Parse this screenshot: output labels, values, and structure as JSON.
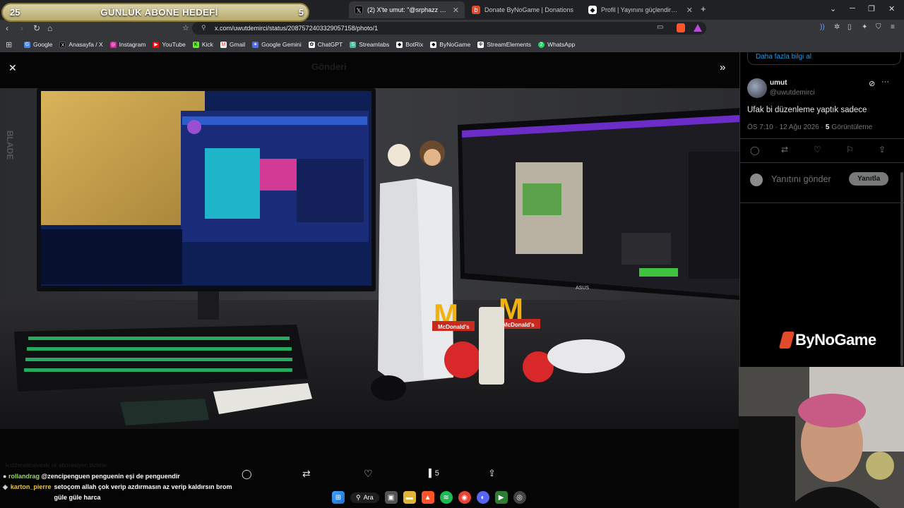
{
  "overlay": {
    "goal_left": "25",
    "goal_title": "GÜNLÜK ABONE HEDEFİ",
    "goal_right": "5"
  },
  "tabs": [
    {
      "label": "(2) X'te umut: \"@srphazz @setoi",
      "active": true
    },
    {
      "label": "Donate ByNoGame | Donations",
      "active": false
    },
    {
      "label": "Profil | Yayınını güçlendirmek için en",
      "active": false
    }
  ],
  "address": {
    "url": "x.com/uwutdemirci/status/2087572403329057158/photo/1"
  },
  "bookmarks": [
    "Google",
    "Anasayfa / X",
    "Instagram",
    "YouTube",
    "Kick",
    "Gmail",
    "Google Gemini",
    "ChatGPT",
    "Streamlabs",
    "BotRix",
    "ByNoGame",
    "StreamElements",
    "WhatsApp"
  ],
  "viewer": {
    "faded_title": "Gönderi",
    "stats": {
      "views": "5"
    },
    "bg_text": "kuzzeneticalveski ok abonesiyen bizimle"
  },
  "tweet": {
    "more_info": "Daha fazla bilgi al",
    "author_name": "umut",
    "author_handle": "@uwutdemirci",
    "text": "Ufak bi düzenleme yaptık sadece",
    "time": "ÖS 7:10 · 12 Ağu 2026 ·",
    "views_count": "5",
    "views_label": "Görüntüleme",
    "reply_placeholder": "Yanıtını gönder",
    "reply_button": "Yanıtla"
  },
  "brand": {
    "logo_text": "ByNoGame"
  },
  "photo": {
    "left_monitor_brand": "BLADE",
    "right_monitor_brand": "ASUS",
    "mcd_sign_1": "McDonald's",
    "mcd_sign_2": "McDonald's"
  },
  "chat": [
    {
      "user": "rollandrag",
      "user_color": "#8fdc5a",
      "text": "@zencipenguen penguenin eşi de penguendir"
    },
    {
      "user": "karton_pierre",
      "user_color": "#e8c64a",
      "text": "setoçom allah çok verip azdırmasın az verip kaldırsın brom güle güle harca"
    }
  ],
  "taskbar": {
    "search_label": "Ara"
  },
  "colors": {
    "accent": "#1d9bf0",
    "tab_bg": "#202124",
    "toolbar_bg": "#35363a"
  }
}
